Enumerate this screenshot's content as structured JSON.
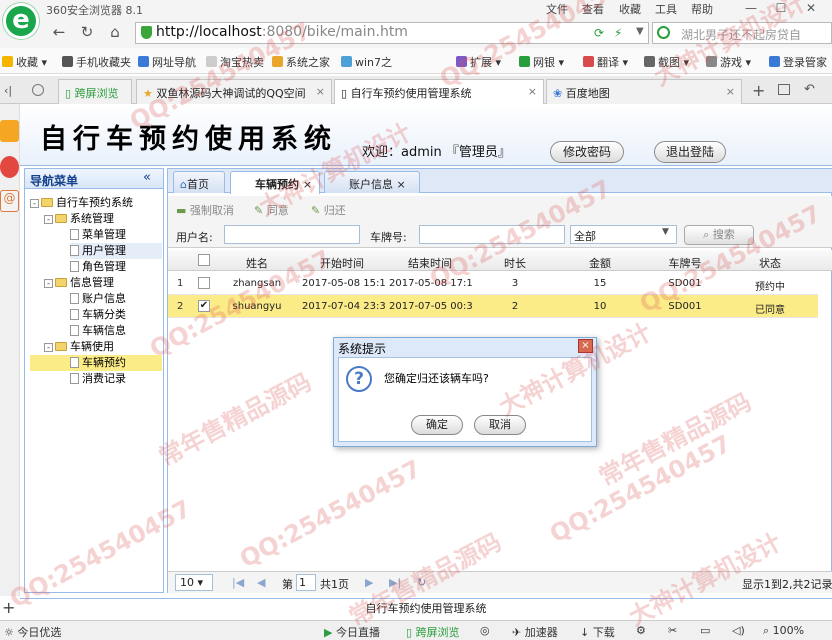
{
  "browser": {
    "name": "360安全浏览器 8.1",
    "menu": [
      "文件",
      "查看",
      "收藏",
      "工具",
      "帮助"
    ],
    "url_host": "http://localhost",
    "url_rest": ":8080/bike/main.htm",
    "search_text": "湖北男子还不起房贷自",
    "bookmarks": [
      "收藏",
      "手机收藏夹",
      "网址导航",
      "淘宝热卖",
      "系统之家",
      "win7之",
      "扩展",
      "网银",
      "翻译",
      "截图",
      "游戏",
      "登录管家"
    ],
    "tabs": [
      "跨屏浏览",
      "双鱼林源码大神调试的QQ空间",
      "自行车预约使用管理系统",
      "百度地图"
    ],
    "status_items": [
      "今日优选",
      "今日直播",
      "跨屏浏览",
      "加速器",
      "下载",
      "100%"
    ]
  },
  "app": {
    "title": "自行车预约使用系统",
    "welcome": "欢迎：admin 『管理员』",
    "change_password": "修改密码",
    "logout": "退出登陆",
    "footer": "自行车预约使用管理系统"
  },
  "nav": {
    "title": "导航菜单",
    "collapse": "«",
    "root": "自行车预约系统",
    "groups": [
      {
        "label": "系统管理",
        "items": [
          "菜单管理",
          "用户管理",
          "角色管理"
        ]
      },
      {
        "label": "信息管理",
        "items": [
          "账户信息",
          "车辆分类",
          "车辆信息"
        ]
      },
      {
        "label": "车辆使用",
        "items": [
          "车辆预约",
          "消费记录"
        ]
      }
    ]
  },
  "tabs": [
    "首页",
    "车辆预约",
    "账户信息"
  ],
  "toolbar": {
    "force_cancel": "强制取消",
    "agree": "同意",
    "return": "归还"
  },
  "search": {
    "user_label": "用户名:",
    "plate_label": "车牌号:",
    "status_value": "全部",
    "button": "搜索"
  },
  "grid": {
    "columns": [
      "姓名",
      "开始时间",
      "结束时间",
      "时长",
      "金额",
      "车牌号",
      "状态"
    ],
    "rows": [
      {
        "num": "1",
        "name": "zhangsan",
        "start": "2017-05-08 15:1!",
        "end": "2017-05-08 17:1!",
        "hours": "3",
        "amount": "15",
        "plate": "SD001",
        "status": "预约中",
        "checked": ""
      },
      {
        "num": "2",
        "name": "shuangyu",
        "start": "2017-07-04 23:3!",
        "end": "2017-07-05 00:3!",
        "hours": "2",
        "amount": "10",
        "plate": "SD001",
        "status": "已同意",
        "checked": "✔"
      }
    ]
  },
  "pager": {
    "page_size": "10",
    "page_prefix": "第",
    "page_value": "1",
    "page_suffix": "共1页",
    "summary": "显示1到2,共2记录"
  },
  "dialog": {
    "title": "系统提示",
    "message": "您确定归还该辆车吗?",
    "ok": "确定",
    "cancel": "取消",
    "icon": "?"
  },
  "watermark": [
    "QQ:254540457",
    "大神计算机设计",
    "常年售精品源码"
  ]
}
